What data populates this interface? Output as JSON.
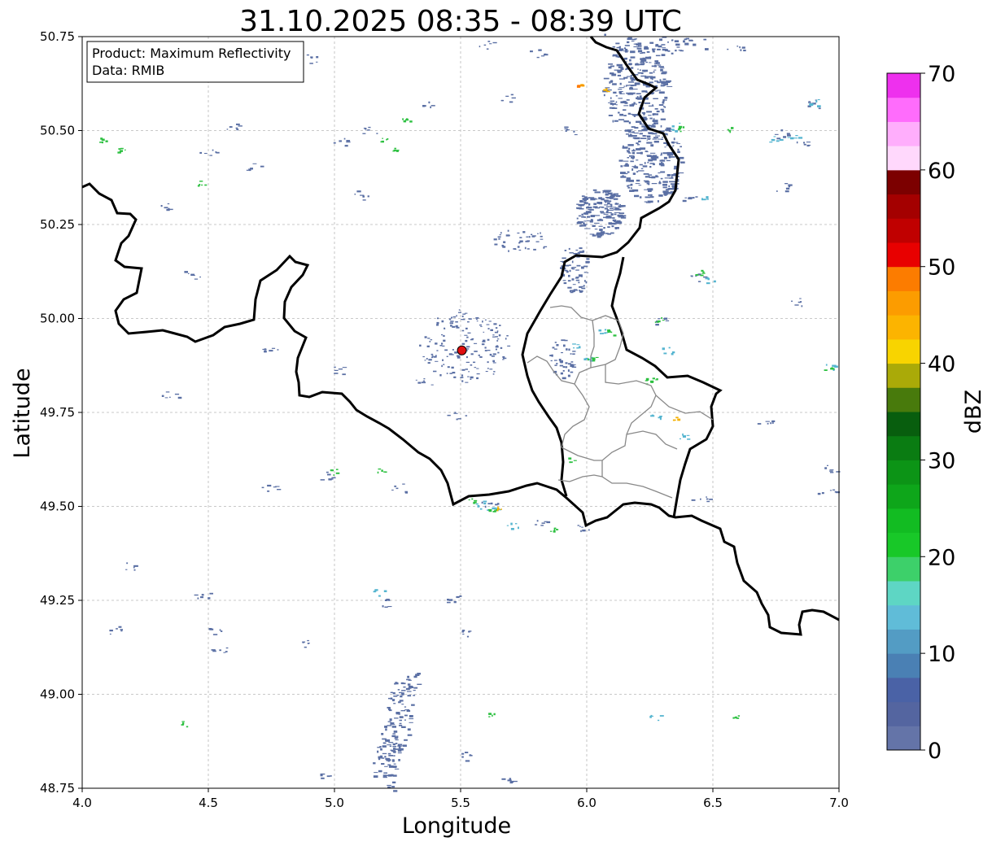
{
  "title": "31.10.2025 08:35 - 08:39 UTC",
  "info_box": {
    "line1": "Product: Maximum Reflectivity",
    "line2": "Data: RMIB"
  },
  "chart_data": {
    "type": "map",
    "xlabel": "Longitude",
    "ylabel": "Latitude",
    "xlim": [
      4.0,
      7.0
    ],
    "ylim": [
      48.75,
      50.75
    ],
    "xticks": [
      "4.0",
      "4.5",
      "5.0",
      "5.5",
      "6.0",
      "6.5",
      "7.0"
    ],
    "yticks": [
      "48.75",
      "49.00",
      "49.25",
      "49.50",
      "49.75",
      "50.00",
      "50.25",
      "50.50",
      "50.75"
    ],
    "grid": true,
    "radar_site": {
      "lon": 5.505,
      "lat": 49.915,
      "color": "#e01010"
    },
    "colorbar": {
      "label": "dBZ",
      "range": [
        0,
        70
      ],
      "ticks": [
        "0",
        "10",
        "20",
        "30",
        "40",
        "50",
        "60",
        "70"
      ],
      "colors": [
        "#6474a8",
        "#5465a0",
        "#4a62a6",
        "#4a80b4",
        "#539cc4",
        "#60bcd8",
        "#5ed6c4",
        "#3dd06a",
        "#18c828",
        "#12bc22",
        "#0ea61a",
        "#0c9416",
        "#0a7c12",
        "#085e0e",
        "#487a0c",
        "#aaaa08",
        "#f8d400",
        "#fcb400",
        "#fc9c00",
        "#fc7c00",
        "#e80000",
        "#c00000",
        "#a40000",
        "#7c0000",
        "#ffd8fc",
        "#ffaefc",
        "#ff6cfc",
        "#ee30ee"
      ]
    },
    "echo_colors": {
      "weak": "#5a6fa4",
      "light": "#55b5d0",
      "moderate": "#2cc040",
      "strong": "#f4b000",
      "intense": "#ff7a00"
    }
  }
}
